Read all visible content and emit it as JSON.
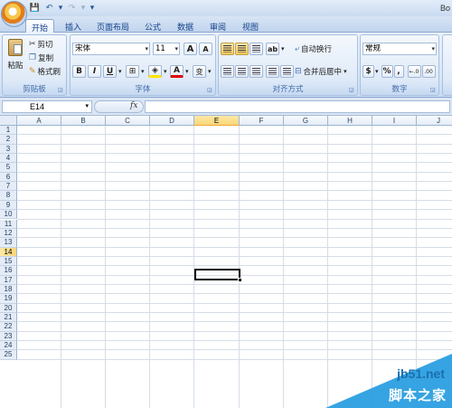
{
  "title": {
    "app_label": "Bo"
  },
  "qat": {
    "save": "💾",
    "undo": "↶",
    "undo_dd": "▾",
    "redo": "↷",
    "redo_dd": "▾",
    "customize": "▾"
  },
  "tabs": [
    "开始",
    "插入",
    "页面布局",
    "公式",
    "数据",
    "审阅",
    "视图"
  ],
  "clipboard": {
    "paste": "粘贴",
    "cut": "剪切",
    "copy": "复制",
    "format_painter": "格式刷",
    "label": "剪贴板"
  },
  "font": {
    "name": "宋体",
    "size": "11",
    "grow": "A",
    "shrink": "A",
    "bold": "B",
    "italic": "I",
    "underline": "U",
    "border": "⊞",
    "fill": "◈",
    "color": "A",
    "phonetic": "变",
    "label": "字体"
  },
  "alignment": {
    "wrap": "自动换行",
    "merge": "合并后居中",
    "label": "对齐方式"
  },
  "number": {
    "format": "常规",
    "currency": "$",
    "percent": "%",
    "comma": ",",
    "inc_decimal": "←.0",
    "dec_decimal": ".00",
    "label": "数字"
  },
  "formula_bar": {
    "cell_ref": "E14",
    "fx": "fx",
    "value": ""
  },
  "grid": {
    "columns": [
      "A",
      "B",
      "C",
      "D",
      "E",
      "F",
      "G",
      "H",
      "I",
      "J"
    ],
    "rows": [
      "1",
      "2",
      "3",
      "4",
      "5",
      "6",
      "7",
      "8",
      "9",
      "10",
      "11",
      "12",
      "13",
      "14",
      "15",
      "16",
      "17",
      "18",
      "19",
      "20",
      "21",
      "22",
      "23",
      "24",
      "25"
    ],
    "selected_column": "E",
    "selected_row": "14"
  },
  "watermark": {
    "url": "jb51.net",
    "site": "脚本之家"
  },
  "colors": {
    "accent": "#15428b",
    "ribbon": "#dfeaf8",
    "selection": "#f9d778",
    "grid_line": "#d6dde6",
    "watermark": "#2b9fe0"
  }
}
